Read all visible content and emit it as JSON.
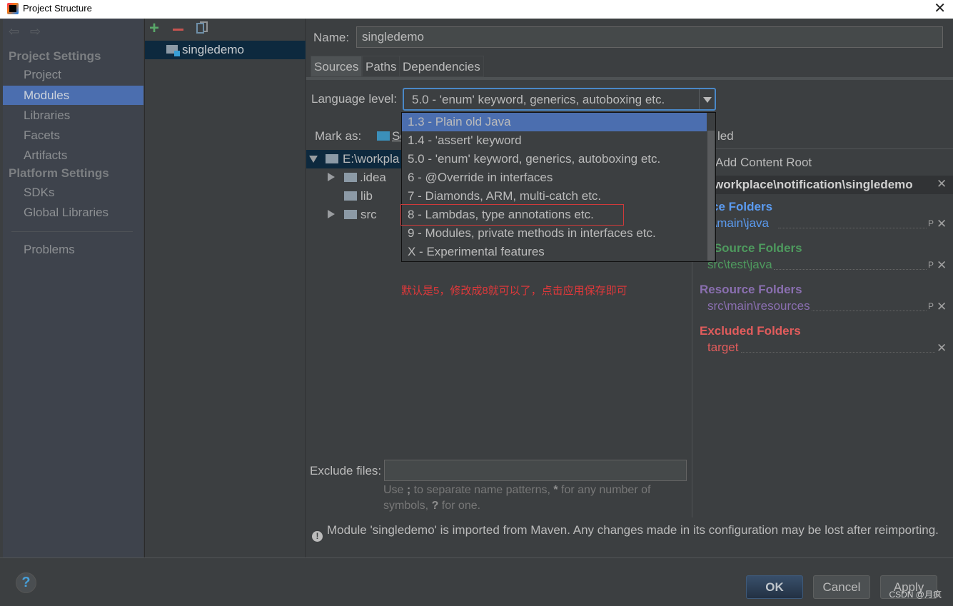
{
  "window": {
    "title": "Project Structure",
    "close_glyph": "✕"
  },
  "sidebar": {
    "back_glyph": "⇦",
    "forward_glyph": "⇨",
    "project_settings_title": "Project Settings",
    "project_items": [
      {
        "label": "Project",
        "selected": false
      },
      {
        "label": "Modules",
        "selected": true
      },
      {
        "label": "Libraries",
        "selected": false
      },
      {
        "label": "Facets",
        "selected": false
      },
      {
        "label": "Artifacts",
        "selected": false
      }
    ],
    "platform_settings_title": "Platform Settings",
    "platform_items": [
      {
        "label": "SDKs"
      },
      {
        "label": "Global Libraries"
      }
    ],
    "problems_label": "Problems"
  },
  "modules": {
    "add_glyph": "+",
    "items": [
      {
        "label": "singledemo",
        "selected": true
      }
    ]
  },
  "main": {
    "name_label": "Name:",
    "name_value": "singledemo",
    "tabs": [
      {
        "label": "Sources",
        "active": true
      },
      {
        "label": "Paths",
        "active": false
      },
      {
        "label": "Dependencies",
        "active": false
      }
    ],
    "language_level": {
      "label": "Language level:",
      "selected": "5.0 - 'enum' keyword, generics, autoboxing etc.",
      "options": [
        "1.3 - Plain old Java",
        "1.4 - 'assert' keyword",
        "5.0 - 'enum' keyword, generics, autoboxing etc.",
        "6 - @Override in interfaces",
        "7 - Diamonds, ARM, multi-catch etc.",
        "8 - Lambdas, type annotations etc.",
        "9 - Modules, private methods in interfaces etc.",
        "X - Experimental features"
      ],
      "highlighted_index": 0,
      "boxed_index": 5
    },
    "mark_as": {
      "label": "Mark as:",
      "visible_fragment": "So",
      "right_fragment": "led"
    },
    "tree": [
      {
        "label": "E:\\workpla",
        "expanded": true,
        "depth": 0,
        "selected": true
      },
      {
        "label": ".idea",
        "expanded": false,
        "depth": 1,
        "has_children": true
      },
      {
        "label": "lib",
        "depth": 1,
        "has_children": false
      },
      {
        "label": "src",
        "expanded": false,
        "depth": 1,
        "has_children": true
      }
    ],
    "annotation": "默认是5，修改成8就可以了，点击应用保存即可",
    "content_root": {
      "add_label": "Add Content Root",
      "path": "workplace\\notification\\singledemo",
      "groups": [
        {
          "title": "urce Folders",
          "path": "c\\main\\java",
          "color": "#5b9bf0"
        },
        {
          "title": "st Source Folders",
          "path": "src\\test\\java",
          "color": "#4e9a5e"
        },
        {
          "title": "Resource Folders",
          "path": "src\\main\\resources",
          "color": "#8a6fb0"
        },
        {
          "title": "Excluded Folders",
          "path": "target",
          "color": "#e25c5c"
        }
      ],
      "props_glyph": "P",
      "remove_glyph": "✕"
    },
    "exclude": {
      "label": "Exclude files:",
      "value": "",
      "hint_parts": [
        "Use ",
        ";",
        " to separate name patterns, ",
        "*",
        " for any number of symbols, ",
        "?",
        " for one."
      ]
    },
    "warning": "Module 'singledemo' is imported from Maven. Any changes made in its configuration may be lost after reimporting.",
    "warning_glyph": "!"
  },
  "footer": {
    "help_glyph": "?",
    "ok_label": "OK",
    "cancel_label": "Cancel",
    "apply_label": "Apply",
    "watermark": "CSDN @月疯"
  }
}
